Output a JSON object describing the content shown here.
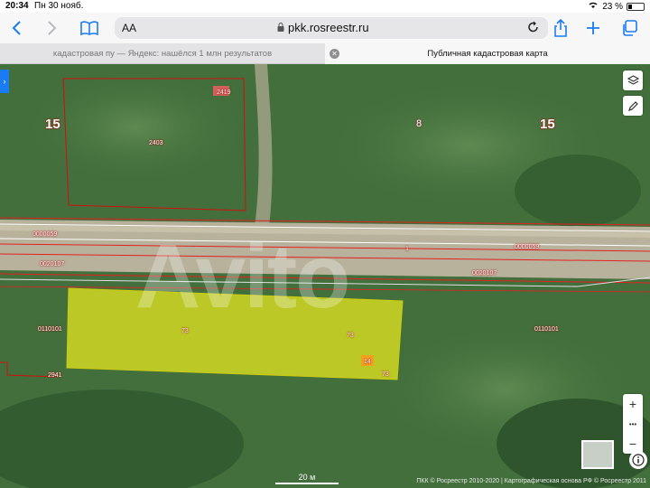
{
  "status_bar": {
    "time": "20:34",
    "date": "Пн 30 нояб.",
    "battery": "23 %"
  },
  "toolbar": {
    "text_size_label": "AA",
    "url": "pkk.rosreestr.ru"
  },
  "tabs": [
    {
      "label": "кадастровая пу — Яндекс: нашёлся 1 млн результатов",
      "active": false
    },
    {
      "label": "Публичная кадастровая карта",
      "active": true
    }
  ],
  "map": {
    "big_numbers": [
      "15",
      "15"
    ],
    "small_number": "8",
    "road_number": "1",
    "labels": {
      "house": "2419",
      "plot_top": "2403",
      "road_left": "0000059",
      "road_right": "0000059",
      "strip_left": "0020107",
      "strip_right": "0020107",
      "field_left": "0110101",
      "field_right": "0110101",
      "plot_yellow_1": "73",
      "plot_yellow_2": "73",
      "plot_yellow_3": "73",
      "plot_small": "14",
      "plot_bottom_left": "2941"
    },
    "watermark": "Avito",
    "scale_label": "20 м",
    "copyright": "ПКК © Росреестр 2010-2020 | Картографическая основа РФ © Росреестр 2011",
    "zoom_in": "+",
    "zoom_more": "•••",
    "zoom_out": "−"
  },
  "colors": {
    "accent": "#1a7cf5",
    "boundary": "#d01010",
    "selected_plot": "#e4e61e"
  }
}
